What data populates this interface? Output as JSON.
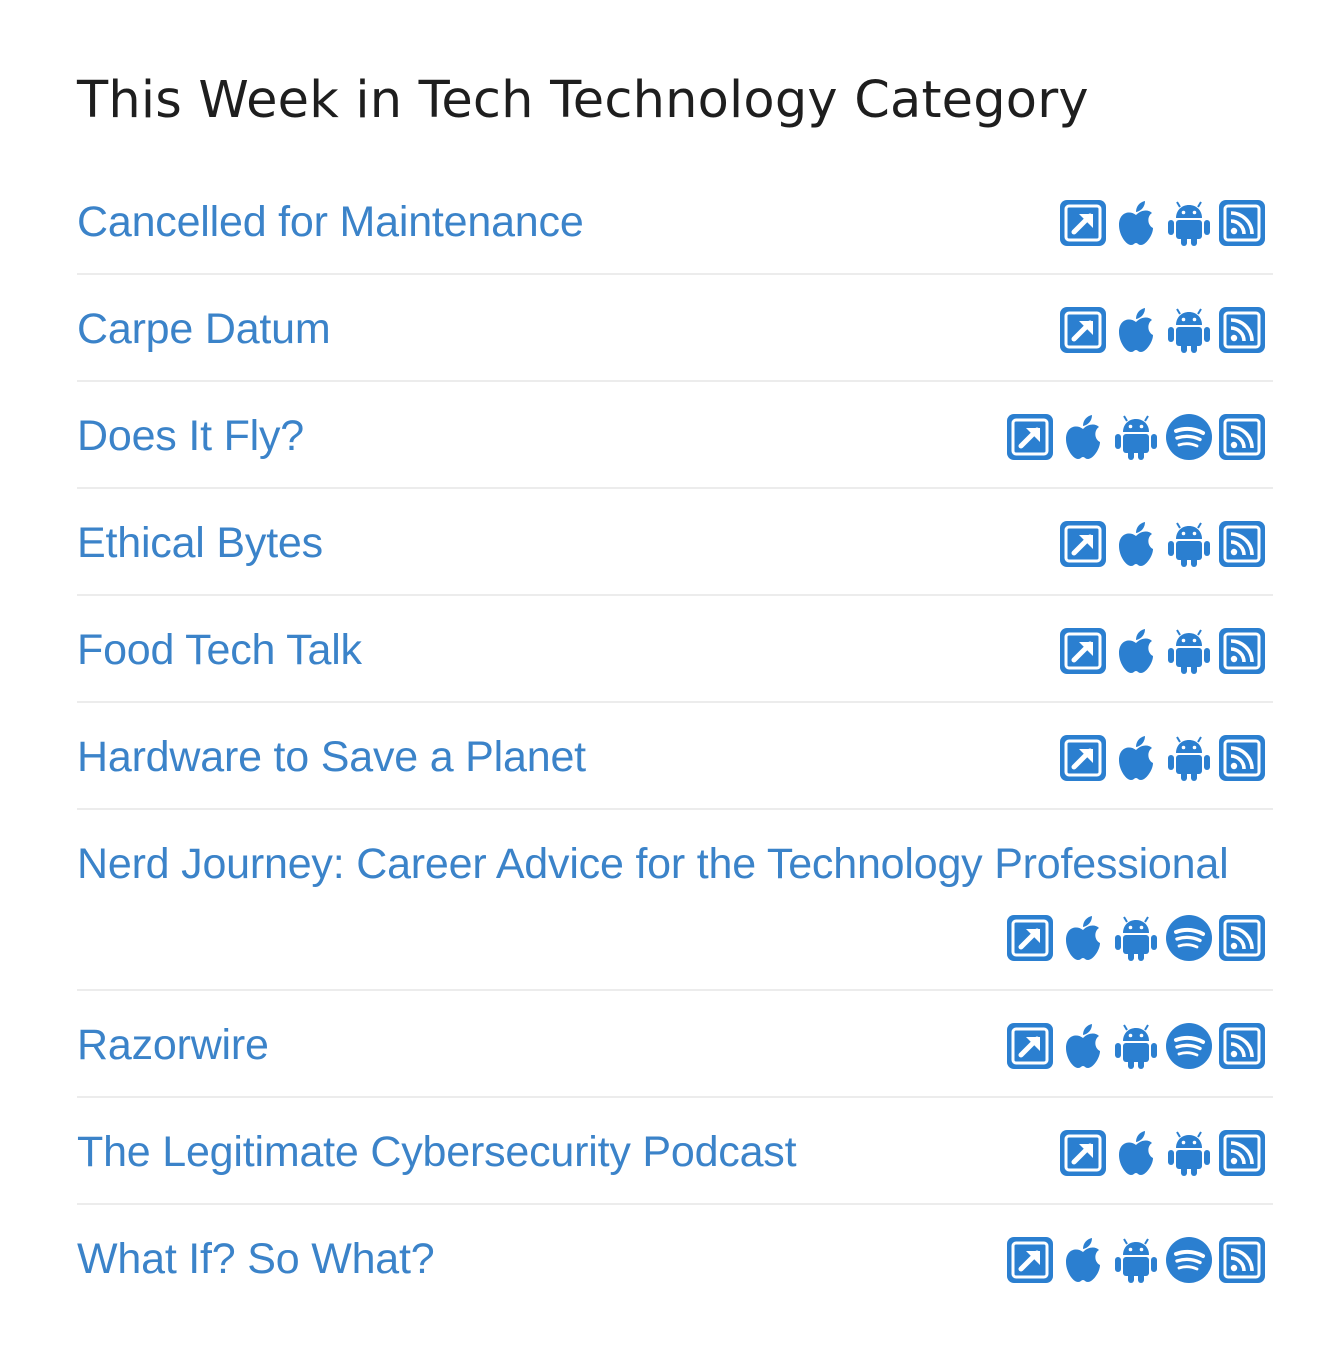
{
  "page": {
    "title": "This Week in Tech Technology Category"
  },
  "colors": {
    "link": "#3b83c9",
    "icon": "#2b7fd0",
    "title": "#1e1e1e",
    "divider": "#ececec"
  },
  "icon_names": {
    "web": "external-link-icon",
    "apple": "apple-podcasts-icon",
    "android": "android-icon",
    "spotify": "spotify-icon",
    "rss": "rss-feed-icon"
  },
  "podcasts": [
    {
      "name": "Cancelled for Maintenance",
      "links": [
        "web",
        "apple",
        "android",
        "rss"
      ]
    },
    {
      "name": "Carpe Datum",
      "links": [
        "web",
        "apple",
        "android",
        "rss"
      ]
    },
    {
      "name": "Does It Fly?",
      "links": [
        "web",
        "apple",
        "android",
        "spotify",
        "rss"
      ]
    },
    {
      "name": "Ethical Bytes",
      "links": [
        "web",
        "apple",
        "android",
        "rss"
      ]
    },
    {
      "name": "Food Tech Talk",
      "links": [
        "web",
        "apple",
        "android",
        "rss"
      ]
    },
    {
      "name": "Hardware to Save a Planet",
      "links": [
        "web",
        "apple",
        "android",
        "rss"
      ]
    },
    {
      "name": "Nerd Journey: Career Advice for the Technology Professional",
      "links": [
        "web",
        "apple",
        "android",
        "spotify",
        "rss"
      ]
    },
    {
      "name": "Razorwire",
      "links": [
        "web",
        "apple",
        "android",
        "spotify",
        "rss"
      ]
    },
    {
      "name": "The Legitimate Cybersecurity Podcast",
      "links": [
        "web",
        "apple",
        "android",
        "rss"
      ]
    },
    {
      "name": "What If? So What?",
      "links": [
        "web",
        "apple",
        "android",
        "spotify",
        "rss"
      ]
    }
  ]
}
